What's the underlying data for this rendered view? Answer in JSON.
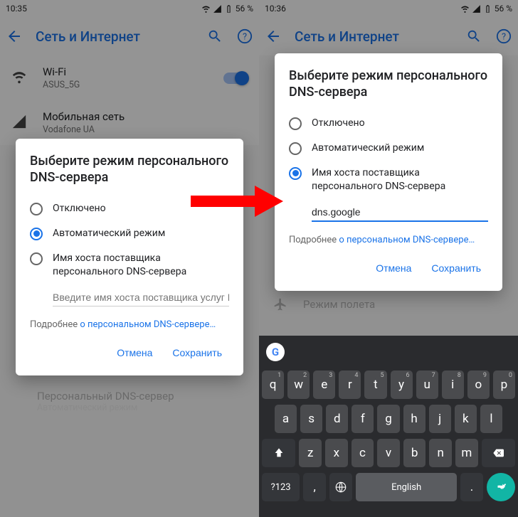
{
  "left": {
    "statusbar": {
      "time": "10:35",
      "battery": "56 %"
    },
    "appbar": {
      "title": "Сеть и Интернет"
    },
    "list": {
      "wifi": {
        "label": "Wi-Fi",
        "sub": "ASUS_5G"
      },
      "mobile": {
        "label": "Мобильная сеть",
        "sub": "Vodafone UA"
      },
      "privdns": {
        "label": "Персональный DNS-сервер",
        "sub": "Автоматический режим"
      }
    },
    "dialog": {
      "title": "Выберите режим персонального DNS-сервера",
      "opt_off": "Отключено",
      "opt_auto": "Автоматический режим",
      "opt_host": "Имя хоста поставщика персонального DNS-сервера",
      "input_placeholder": "Введите имя хоста поставщика услуг DNS",
      "hint_prefix": "Подробнее ",
      "hint_link": "о персональном DNS-сервере…",
      "cancel": "Отмена",
      "save": "Сохранить"
    }
  },
  "right": {
    "statusbar": {
      "time": "10:36",
      "battery": "56 %"
    },
    "appbar": {
      "title": "Сеть и Интернет"
    },
    "list": {
      "airplane": {
        "label": "Режим полета"
      }
    },
    "dialog": {
      "title": "Выберите режим персонального DNS-сервера",
      "opt_off": "Отключено",
      "opt_auto": "Автоматический режим",
      "opt_host": "Имя хоста поставщика персонального DNS-сервера",
      "input_value": "dns.google",
      "hint_prefix": "Подробнее ",
      "hint_link": "о персональном DNS-сервере…",
      "cancel": "Отмена",
      "save": "Сохранить"
    },
    "keyboard": {
      "row1": [
        "q",
        "w",
        "e",
        "r",
        "t",
        "y",
        "u",
        "i",
        "o",
        "p"
      ],
      "sup1": [
        "1",
        "2",
        "3",
        "4",
        "5",
        "6",
        "7",
        "8",
        "9",
        "0"
      ],
      "row2": [
        "a",
        "s",
        "d",
        "f",
        "g",
        "h",
        "j",
        "k",
        "l"
      ],
      "row3": [
        "z",
        "x",
        "c",
        "v",
        "b",
        "n",
        "m"
      ],
      "space_label": "English",
      "symkey": "?123"
    }
  }
}
